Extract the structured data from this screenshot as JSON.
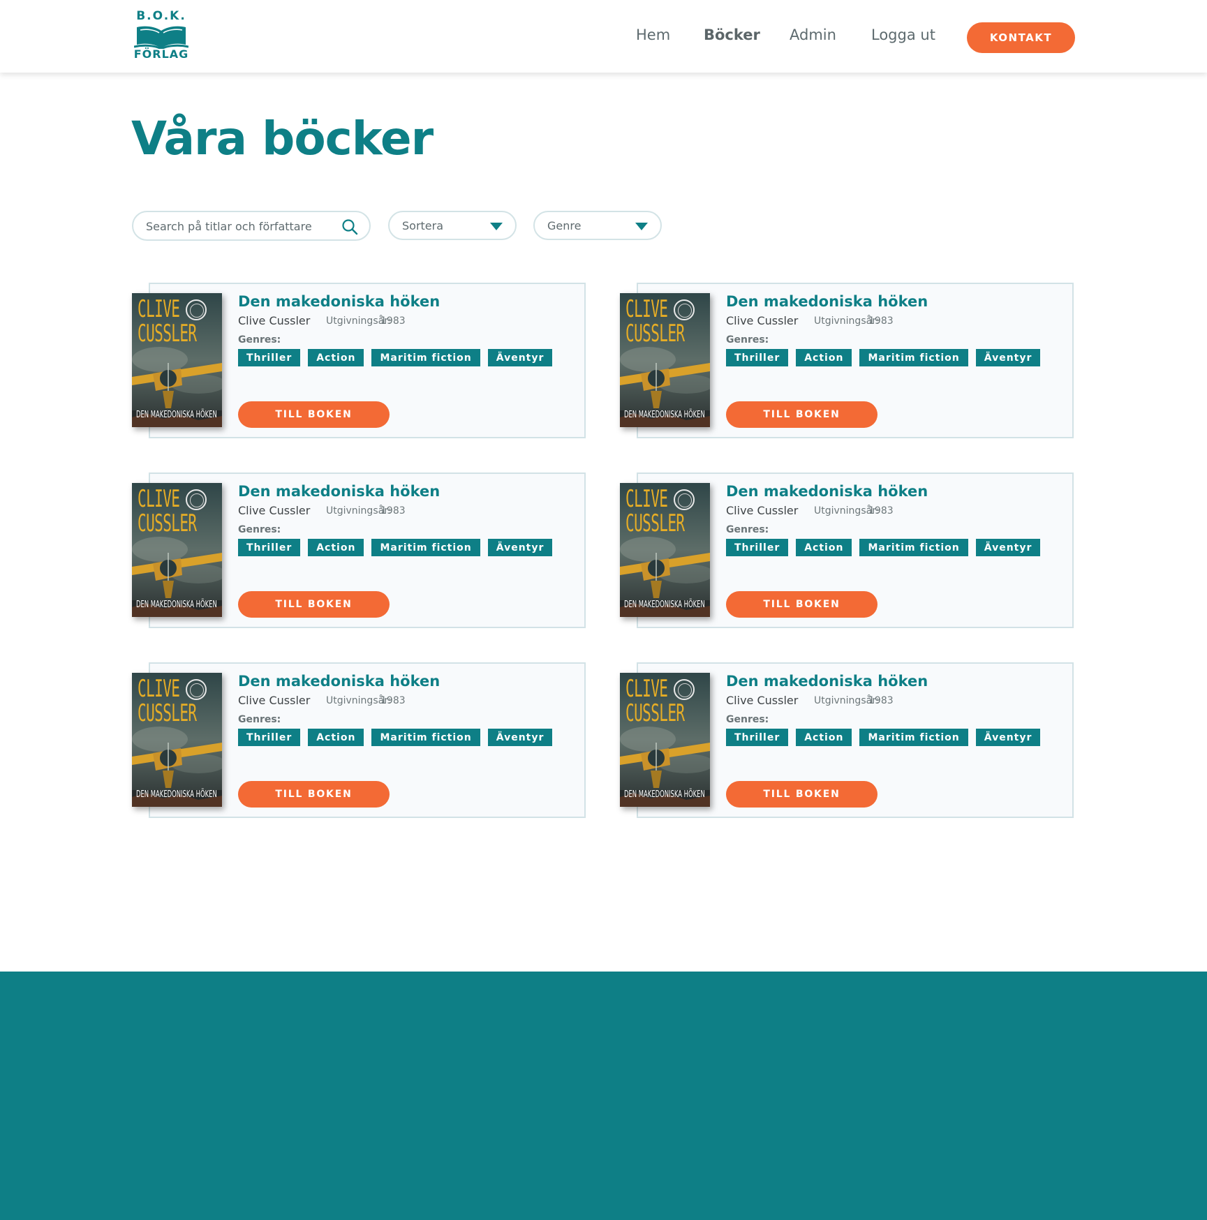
{
  "brand": {
    "line1": "B.O.K.",
    "line2": "FÖRLAG",
    "color": "#0e7f86"
  },
  "nav": {
    "items": [
      {
        "label": "Hem"
      },
      {
        "label": "Böcker"
      },
      {
        "label": "Admin"
      },
      {
        "label": "Logga ut"
      }
    ],
    "active": "Böcker",
    "contact_label": "KONTAKT"
  },
  "page": {
    "title": "Våra böcker"
  },
  "filters": {
    "search_placeholder": "Search på titlar och författare",
    "sort_label": "Sortera",
    "genre_label": "Genre"
  },
  "books": [
    {
      "title": "Den makedoniska höken",
      "author": "Clive Cussler",
      "year_label": "Utgivningsår:",
      "year": "1983",
      "genres_label": "Genres:",
      "genres": [
        "Thriller",
        "Action",
        "Maritim fiction",
        "Äventyr"
      ],
      "button": "TILL BOKEN",
      "cover_author": "CLIVE CUSSLER",
      "cover_title": "DEN MAKEDONISKA HÖKEN"
    },
    {
      "title": "Den makedoniska höken",
      "author": "Clive Cussler",
      "year_label": "Utgivningsår:",
      "year": "1983",
      "genres_label": "Genres:",
      "genres": [
        "Thriller",
        "Action",
        "Maritim fiction",
        "Äventyr"
      ],
      "button": "TILL BOKEN",
      "cover_author": "CLIVE CUSSLER",
      "cover_title": "DEN MAKEDONISKA HÖKEN"
    },
    {
      "title": "Den makedoniska höken",
      "author": "Clive Cussler",
      "year_label": "Utgivningsår:",
      "year": "1983",
      "genres_label": "Genres:",
      "genres": [
        "Thriller",
        "Action",
        "Maritim fiction",
        "Äventyr"
      ],
      "button": "TILL BOKEN",
      "cover_author": "CLIVE CUSSLER",
      "cover_title": "DEN MAKEDONISKA HÖKEN"
    },
    {
      "title": "Den makedoniska höken",
      "author": "Clive Cussler",
      "year_label": "Utgivningsår:",
      "year": "1983",
      "genres_label": "Genres:",
      "genres": [
        "Thriller",
        "Action",
        "Maritim fiction",
        "Äventyr"
      ],
      "button": "TILL BOKEN",
      "cover_author": "CLIVE CUSSLER",
      "cover_title": "DEN MAKEDONISKA HÖKEN"
    },
    {
      "title": "Den makedoniska höken",
      "author": "Clive Cussler",
      "year_label": "Utgivningsår:",
      "year": "1983",
      "genres_label": "Genres:",
      "genres": [
        "Thriller",
        "Action",
        "Maritim fiction",
        "Äventyr"
      ],
      "button": "TILL BOKEN",
      "cover_author": "CLIVE CUSSLER",
      "cover_title": "DEN MAKEDONISKA HÖKEN"
    },
    {
      "title": "Den makedoniska höken",
      "author": "Clive Cussler",
      "year_label": "Utgivningsår:",
      "year": "1983",
      "genres_label": "Genres:",
      "genres": [
        "Thriller",
        "Action",
        "Maritim fiction",
        "Äventyr"
      ],
      "button": "TILL BOKEN",
      "cover_author": "CLIVE CUSSLER",
      "cover_title": "DEN MAKEDONISKA HÖKEN"
    }
  ],
  "icons": {
    "search": "search-icon",
    "dropdown": "caret-down-icon",
    "logo": "open-book-icon"
  },
  "colors": {
    "primary": "#0e7f86",
    "accent": "#f36a35",
    "footer": "#0e7f86"
  }
}
